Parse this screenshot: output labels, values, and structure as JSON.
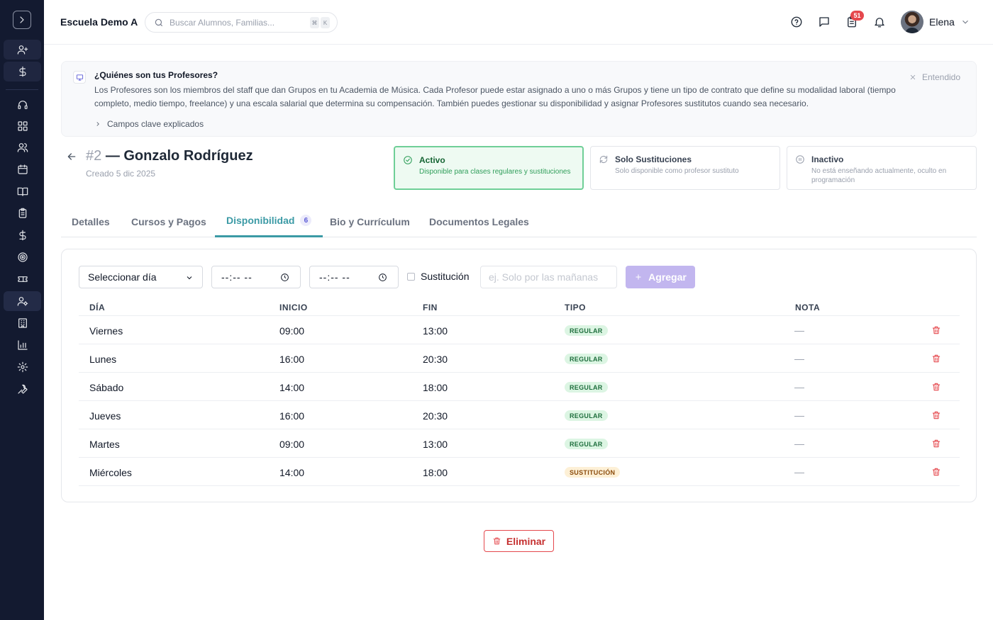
{
  "app": {
    "school_name": "Escuela Demo A",
    "search_placeholder": "Buscar Alumnos, Familias...",
    "search_shortcut": [
      "⌘",
      "K"
    ],
    "notification_count": "51",
    "user_name": "Elena"
  },
  "sidebar": {
    "icons": [
      "user-plus-icon",
      "dollar-icon",
      "headset-icon",
      "dashboard-icon",
      "users-icon",
      "calendar-icon",
      "book-icon",
      "clipboard-icon",
      "dollar-icon",
      "target-icon",
      "ticket-icon",
      "user-gear-icon",
      "building-icon",
      "chart-icon",
      "gear-icon",
      "wrench-icon"
    ],
    "active": "user-gear-icon"
  },
  "banner": {
    "title": "¿Quiénes son tus Profesores?",
    "text": "Los Profesores son los miembros del staff que dan Grupos en tu Academia de Música. Cada Profesor puede estar asignado a uno o más Grupos y tiene un tipo de contrato que define su modalidad laboral (tiempo completo, medio tiempo, freelance) y una escala salarial que determina su compensación. También puedes gestionar su disponibilidad y asignar Profesores sustitutos cuando sea necesario.",
    "link": "Campos clave explicados",
    "dismiss": "Entendido"
  },
  "teacher": {
    "number": "#2",
    "name": "— Gonzalo Rodríguez",
    "created": "Creado 5 dic 2025"
  },
  "status_options": [
    {
      "title": "Activo",
      "desc": "Disponible para clases regulares y sustituciones",
      "selected": true
    },
    {
      "title": "Solo Sustituciones",
      "desc": "Solo disponible como profesor sustituto",
      "selected": false
    },
    {
      "title": "Inactivo",
      "desc": "No está enseñando actualmente, oculto en programación",
      "selected": false
    }
  ],
  "tabs": [
    {
      "label": "Detalles"
    },
    {
      "label": "Cursos y Pagos"
    },
    {
      "label": "Disponibilidad",
      "count": "6",
      "active": true
    },
    {
      "label": "Bio y Currículum"
    },
    {
      "label": "Documentos Legales"
    }
  ],
  "form": {
    "day_select": "Seleccionar día",
    "start_time": "--:-- --",
    "end_time": "--:-- --",
    "substitution_label": "Sustitución",
    "note_placeholder": "ej. Solo por las mañanas",
    "add_label": "Agregar"
  },
  "table": {
    "headers": {
      "day": "DÍA",
      "start": "INICIO",
      "end": "FIN",
      "type": "TIPO",
      "note": "NOTA"
    },
    "rows": [
      {
        "day": "Viernes",
        "start": "09:00",
        "end": "13:00",
        "type": "REGULAR",
        "note": "—"
      },
      {
        "day": "Lunes",
        "start": "16:00",
        "end": "20:30",
        "type": "REGULAR",
        "note": "—"
      },
      {
        "day": "Sábado",
        "start": "14:00",
        "end": "18:00",
        "type": "REGULAR",
        "note": "—"
      },
      {
        "day": "Jueves",
        "start": "16:00",
        "end": "20:30",
        "type": "REGULAR",
        "note": "—"
      },
      {
        "day": "Martes",
        "start": "09:00",
        "end": "13:00",
        "type": "REGULAR",
        "note": "—"
      },
      {
        "day": "Miércoles",
        "start": "14:00",
        "end": "18:00",
        "type": "SUSTITUCIÓN",
        "note": "—"
      }
    ]
  },
  "delete_label": "Eliminar",
  "colors": {
    "sidebar": "#131a30",
    "accent_tab": "#3b9aa5",
    "active_status": "#6fcf97",
    "add_button": "#c2b6ef",
    "danger": "#e5484d"
  }
}
